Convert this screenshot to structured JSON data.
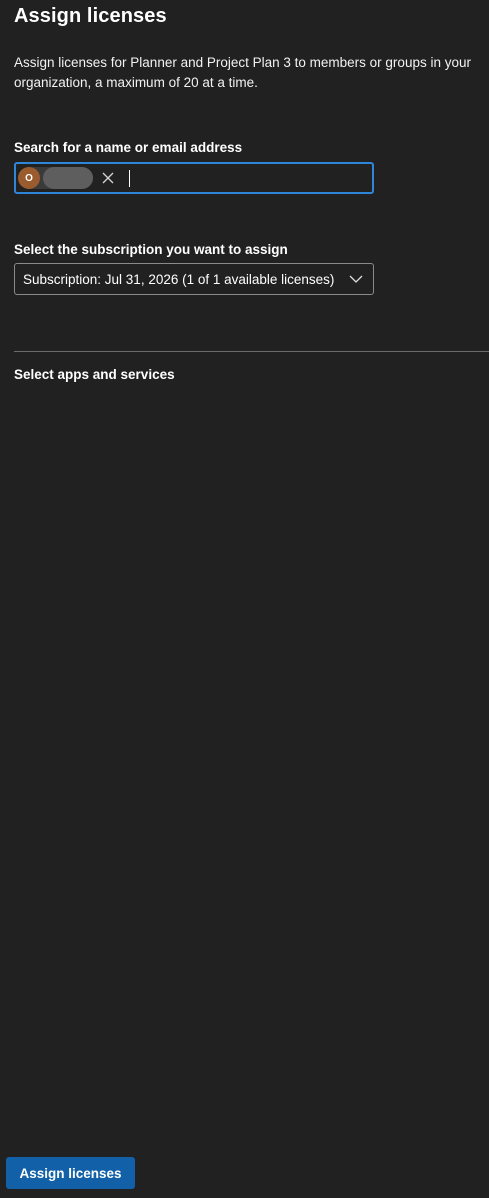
{
  "panel": {
    "title": "Assign licenses",
    "description": "Assign licenses for Planner and Project Plan 3 to members or groups in your organization, a maximum of 20 at a time."
  },
  "search": {
    "label": "Search for a name or email address",
    "selected_person": {
      "initial": "O",
      "avatar_color": "#9a5b2e"
    },
    "remove_icon": "close-icon"
  },
  "subscription": {
    "label": "Select the subscription you want to assign",
    "selected_value": "Subscription: Jul 31, 2026 (1 of 1 available licenses)",
    "icon": "chevron-down-icon"
  },
  "apps": {
    "label": "Select apps and services"
  },
  "footer": {
    "assign_button_label": "Assign licenses"
  },
  "colors": {
    "background": "#212121",
    "focus_border": "#2f85d8",
    "primary_button": "#1160a8"
  }
}
